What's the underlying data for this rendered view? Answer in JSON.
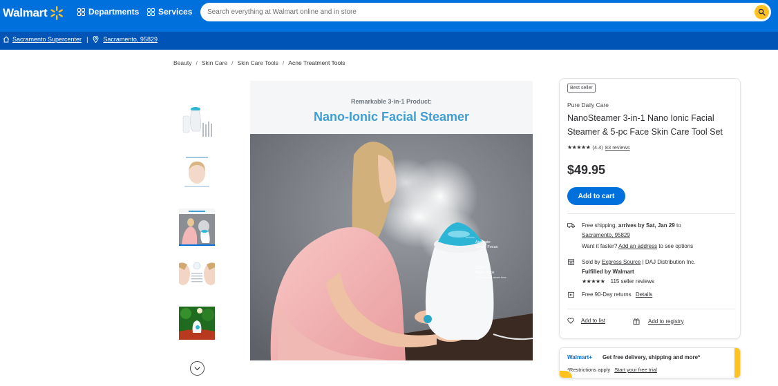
{
  "header": {
    "logo_text": "Walmart",
    "departments_label": "Departments",
    "services_label": "Services",
    "search_placeholder": "Search everything at Walmart online and in store"
  },
  "store_bar": {
    "store_name": "Sacramento Supercenter",
    "separator": "|",
    "location": "Sacramento, 95829"
  },
  "breadcrumb": [
    "Beauty",
    "Skin Care",
    "Skin Care Tools",
    "Acne Treatment Tools"
  ],
  "gallery": {
    "selected_index": 2,
    "hero_subtitle": "Remarkable 3-in-1 Product:",
    "hero_title": "Nano-Ionic Facial Steamer",
    "callout_1_title": "Accurate",
    "callout_1_line2": "Steam Focus",
    "callout_2_title": "200ml",
    "callout_2_line2": "Water Tank",
    "callout_2_line3": "30 minutes of steam time"
  },
  "product": {
    "badge": "Best seller",
    "brand": "Pure Daily Care",
    "title": "NanoSteamer 3-in-1 Nano Ionic Facial Steamer & 5-pc Face Skin Care Tool Set",
    "rating_stars": "★★★★★",
    "rating_value": "(4.4)",
    "reviews_link": "83 reviews",
    "price": "$49.95",
    "add_to_cart": "Add to cart"
  },
  "fulfillment": {
    "shipping_prefix": "Free shipping, ",
    "shipping_arrival": "arrives by Sat, Jan 29",
    "shipping_to": " to",
    "shipping_location": "Sacramento, 95829",
    "faster_prefix": "Want it faster? ",
    "faster_link": "Add an address",
    "faster_suffix": " to see options",
    "sold_by_prefix": "Sold by ",
    "seller_link": "Express Source",
    "seller_suffix": " | DAJ Distribution Inc.",
    "fulfilled_by": "Fulfilled by Walmart",
    "seller_stars": "★★★★★",
    "seller_reviews": "115 seller reviews",
    "returns_text": "Free 90-Day returns",
    "returns_link": "Details"
  },
  "actions": {
    "add_to_list": "Add to list",
    "add_to_registry": "Add to registry"
  },
  "walmart_plus": {
    "logo": "Walmart+",
    "pitch": "Get free delivery, shipping and more*",
    "restrictions": "*Restrictions apply",
    "trial_link": "Start your free trial"
  },
  "colors": {
    "brand_blue": "#0071dc",
    "store_bar_blue": "#0054b5",
    "spark_yellow": "#ffc220",
    "hero_title_blue": "#3f9fd3"
  },
  "icons": [
    "spark-icon",
    "grid-icon",
    "search-icon",
    "home-icon",
    "location-pin-icon",
    "truck-icon",
    "store-icon",
    "returns-icon",
    "heart-icon",
    "gift-icon",
    "chevron-down-icon"
  ]
}
